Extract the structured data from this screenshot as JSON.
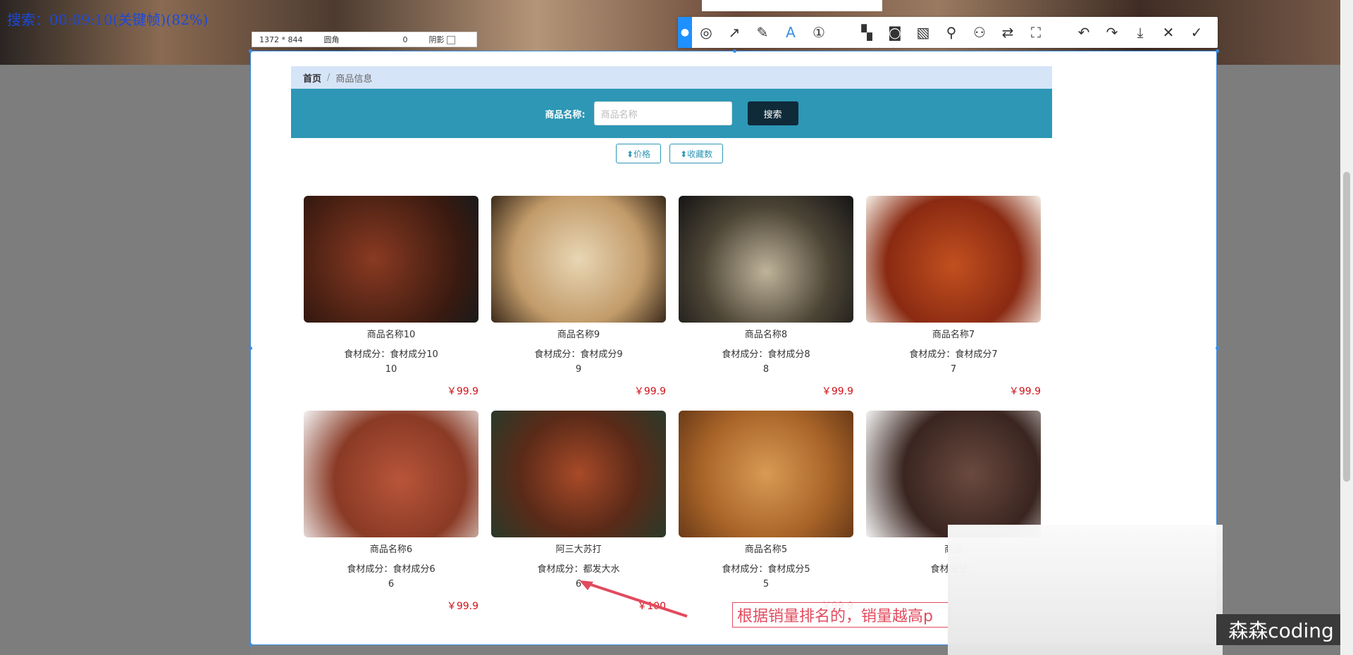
{
  "video_label": "搜索：00:09:10(关键帧)(82%)",
  "capture_info": {
    "size": "1372 * 844",
    "radius_label": "圆角",
    "radius_value": "0",
    "shadow_label": "阴影"
  },
  "breadcrumb": {
    "home": "首页",
    "separator": "/",
    "current": "商品信息"
  },
  "search": {
    "label": "商品名称:",
    "placeholder": "商品名称",
    "button": "搜索"
  },
  "sort": {
    "price": "⬍价格",
    "favorites": "⬍收藏数"
  },
  "products": [
    {
      "name": "商品名称10",
      "ingredients": "食材成分：食材成分10",
      "count": "10",
      "price": "￥99.9",
      "color": "#6b2a1a"
    },
    {
      "name": "商品名称9",
      "ingredients": "食材成分：食材成分9",
      "count": "9",
      "price": "￥99.9",
      "color": "#d9c4a0"
    },
    {
      "name": "商品名称8",
      "ingredients": "食材成分：食材成分8",
      "count": "8",
      "price": "￥99.9",
      "color": "#4d4a3a"
    },
    {
      "name": "商品名称7",
      "ingredients": "食材成分：食材成分7",
      "count": "7",
      "price": "￥99.9",
      "color": "#a13a1e"
    },
    {
      "name": "商品名称6",
      "ingredients": "食材成分：食材成分6",
      "count": "6",
      "price": "￥99.9",
      "color": "#b05a3a"
    },
    {
      "name": "阿三大苏打",
      "ingredients": "食材成分：都发大水",
      "count": "6",
      "price": "￥100",
      "color": "#8a3b20"
    },
    {
      "name": "商品名称5",
      "ingredients": "食材成分：食材成分5",
      "count": "5",
      "price": "￥99.9",
      "color": "#c07a35"
    },
    {
      "name": "商品",
      "ingredients": "食材成分：",
      "count": "",
      "price": "",
      "color": "#5a3a30"
    }
  ],
  "annotation": "根据销量排名的，销量越高p",
  "watermark": "森森coding",
  "toolbar_icons": [
    "pin-icon",
    "shape-icon",
    "arrow-icon",
    "pen-icon",
    "text-icon",
    "number-icon",
    "mosaic-icon",
    "blur-icon",
    "hatch-icon",
    "pin-tool-icon",
    "ocr-icon",
    "translate-icon",
    "scan-icon",
    "undo-icon",
    "redo-icon",
    "download-icon",
    "close-icon",
    "confirm-icon"
  ]
}
